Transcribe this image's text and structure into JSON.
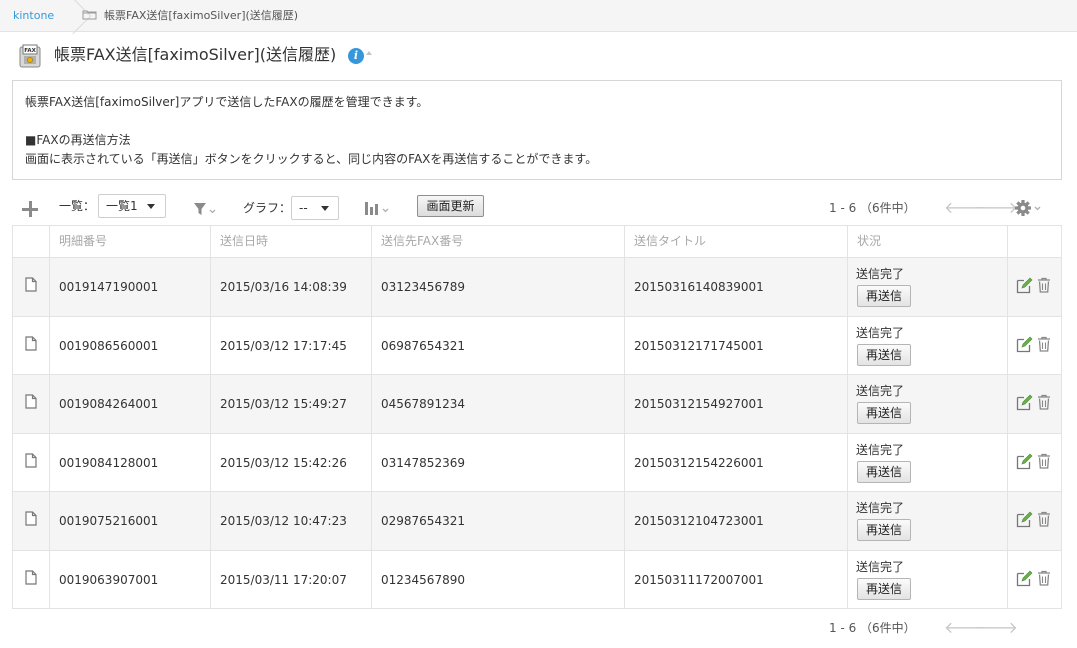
{
  "breadcrumb": {
    "home": "kintone",
    "app": "帳票FAX送信[faximoSilver](送信履歴)"
  },
  "header": {
    "title": "帳票FAX送信[faximoSilver](送信履歴)",
    "info_glyph": "i",
    "app_icon": "fax-icon"
  },
  "description": {
    "line1": "帳票FAX送信[faximoSilver]アプリで送信したFAXの履歴を管理できます。",
    "line3": "■FAXの再送信方法",
    "line4": "画面に表示されている「再送信」ボタンをクリックすると、同じ内容のFAXを再送信することができます。"
  },
  "toolbar": {
    "view_label": "一覧：",
    "view_value": "一覧1",
    "graph_label": "グラフ：",
    "graph_value": "--",
    "refresh_label": "画面更新",
    "pager_text": "1 - 6 （6件中）",
    "prev_arrow": "🡐",
    "next_arrow": "🡒"
  },
  "table": {
    "columns": [
      "明細番号",
      "送信日時",
      "送信先FAX番号",
      "送信タイトル",
      "状況"
    ],
    "rows": [
      {
        "id": "0019147190001",
        "datetime": "2015/03/16 14:08:39",
        "fax": "03123456789",
        "title": "20150316140839001",
        "status": "送信完了",
        "resend": "再送信"
      },
      {
        "id": "0019086560001",
        "datetime": "2015/03/12 17:17:45",
        "fax": "06987654321",
        "title": "20150312171745001",
        "status": "送信完了",
        "resend": "再送信"
      },
      {
        "id": "0019084264001",
        "datetime": "2015/03/12 15:49:27",
        "fax": "04567891234",
        "title": "20150312154927001",
        "status": "送信完了",
        "resend": "再送信"
      },
      {
        "id": "0019084128001",
        "datetime": "2015/03/12 15:42:26",
        "fax": "03147852369",
        "title": "20150312154226001",
        "status": "送信完了",
        "resend": "再送信"
      },
      {
        "id": "0019075216001",
        "datetime": "2015/03/12 10:47:23",
        "fax": "02987654321",
        "title": "20150312104723001",
        "status": "送信完了",
        "resend": "再送信"
      },
      {
        "id": "0019063907001",
        "datetime": "2015/03/11 17:20:07",
        "fax": "01234567890",
        "title": "20150311172007001",
        "status": "送信完了",
        "resend": "再送信"
      }
    ]
  },
  "colors": {
    "link": "#3498db",
    "info": "#3498db",
    "edit_icon": "#6ab04c",
    "row_alt": "#f5f5f5",
    "border": "#e3e3e3"
  }
}
